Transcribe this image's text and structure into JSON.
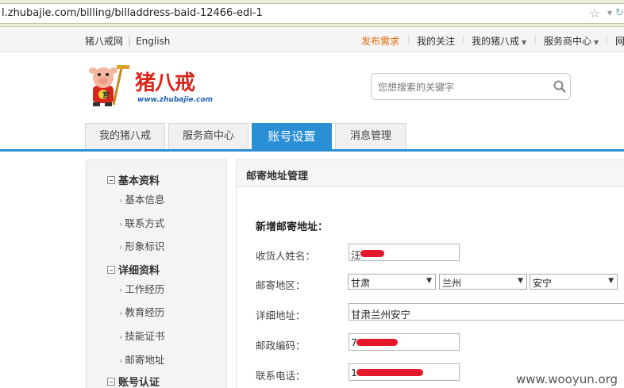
{
  "browser": {
    "url": "l.zhubajie.com/billing/billaddress-baid-12466-edi-1"
  },
  "topnav": {
    "site_name": "猪八戒网",
    "english": "English",
    "publish": "发布需求",
    "follow": "我的关注",
    "my_zbj": "我的猪八戒",
    "provider_center": "服务商中心",
    "truncated": "网"
  },
  "logo": {
    "name": "猪八戒",
    "domain": "www.zhubajie.com",
    "badge": "赏"
  },
  "search": {
    "placeholder": "您想搜索的关键字"
  },
  "tabs": [
    {
      "label": "我的猪八戒"
    },
    {
      "label": "服务商中心"
    },
    {
      "label": "账号设置"
    },
    {
      "label": "消息管理"
    }
  ],
  "sidebar": {
    "groups": [
      {
        "title": "基本资料",
        "items": [
          "基本信息",
          "联系方式",
          "形象标识"
        ]
      },
      {
        "title": "详细资料",
        "items": [
          "工作经历",
          "教育经历",
          "技能证书",
          "邮寄地址"
        ]
      },
      {
        "title": "账号认证",
        "items": []
      }
    ]
  },
  "main": {
    "title": "邮寄地址管理",
    "form_title": "新增邮寄地址：",
    "fields": {
      "name_label": "收货人姓名：",
      "name_value": "汪",
      "region_label": "邮寄地区：",
      "province": "甘肃",
      "city": "兰州",
      "district": "安宁",
      "address_label": "详细地址：",
      "address_value": "甘肃兰州安宁",
      "zip_label": "邮政编码：",
      "zip_value": "7",
      "phone_label": "联系电话：",
      "phone_value": "1"
    }
  },
  "watermark": "www.wooyun.org",
  "colors": {
    "accent": "#2b8fd6",
    "publish": "#e46b0b",
    "redact": "#e5172a"
  }
}
